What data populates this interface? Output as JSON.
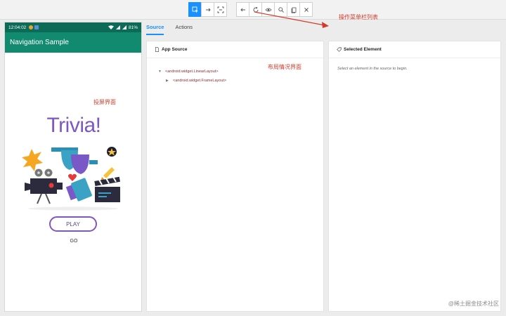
{
  "toolbar": {
    "left_group": [
      {
        "name": "select-elements-button",
        "icon": "pointer-icon",
        "active": true
      },
      {
        "name": "swipe-button",
        "icon": "arrow-right-icon",
        "active": false
      },
      {
        "name": "tap-coordinates-button",
        "icon": "crosshair-icon",
        "active": false
      }
    ],
    "right_group": [
      {
        "name": "back-button",
        "icon": "arrow-left-icon"
      },
      {
        "name": "refresh-button",
        "icon": "refresh-icon"
      },
      {
        "name": "show-hide-button",
        "icon": "eye-icon"
      },
      {
        "name": "search-button",
        "icon": "search-icon"
      },
      {
        "name": "copy-xml-button",
        "icon": "copy-icon"
      },
      {
        "name": "quit-button",
        "icon": "close-icon"
      }
    ]
  },
  "device": {
    "status_time": "12:04:02",
    "battery": "81%",
    "app_title": "Navigation Sample",
    "headline": "Trivia!",
    "play_label": "PLAY",
    "go_label": "GO",
    "accent": "#7e57c2",
    "statusbar_color": "#0b6b57",
    "appbar_color": "#128a6f"
  },
  "tabs": [
    {
      "label": "Source",
      "active": true
    },
    {
      "label": "Actions",
      "active": false
    }
  ],
  "source_panel": {
    "title": "App Source",
    "tree": [
      {
        "tag": "<android.widget.LinearLayout>",
        "caret": "▼",
        "depth": 0
      },
      {
        "tag": "<android.widget.FrameLayout>",
        "caret": "▶",
        "depth": 1
      }
    ]
  },
  "selected_panel": {
    "title": "Selected Element",
    "hint": "Select an element in the source to begin."
  },
  "annotations": {
    "toolbar_note": "操作菜单栏列表",
    "layout_note": "布局情况界面",
    "screen_note": "投屏界面"
  },
  "watermark": "@稀土掘金技术社区",
  "colors": {
    "primary": "#1890ff",
    "annotation": "#d43a2a"
  }
}
